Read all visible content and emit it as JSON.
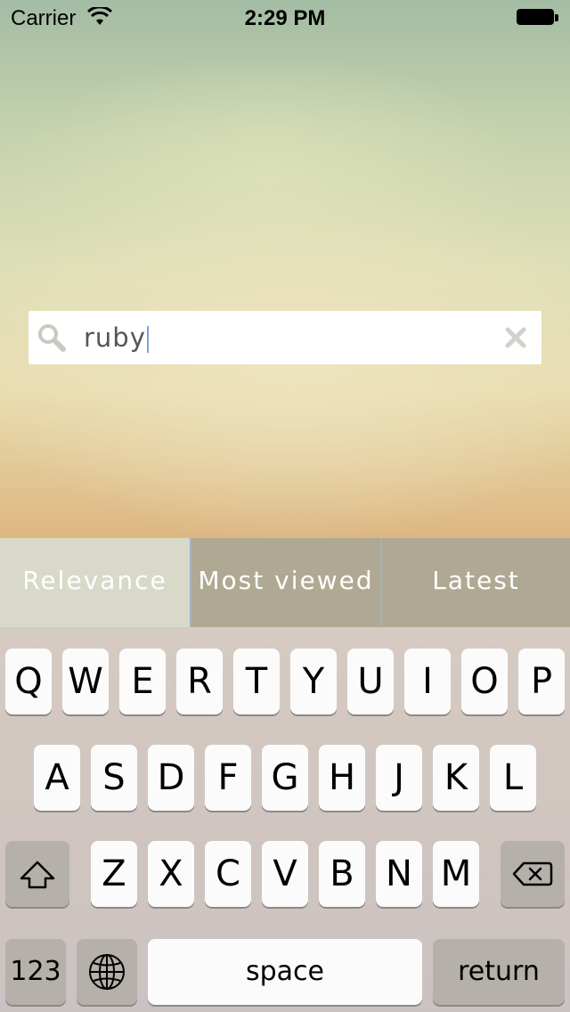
{
  "status_bar": {
    "carrier": "Carrier",
    "time": "2:29 PM"
  },
  "search": {
    "value": "ruby",
    "icon": "search-icon",
    "clear_icon": "clear-icon"
  },
  "sort_tabs": [
    {
      "label": "Relevance",
      "active": true
    },
    {
      "label": "Most viewed",
      "active": false
    },
    {
      "label": "Latest",
      "active": false
    }
  ],
  "keyboard": {
    "row1": [
      "Q",
      "W",
      "E",
      "R",
      "T",
      "Y",
      "U",
      "I",
      "O",
      "P"
    ],
    "row2": [
      "A",
      "S",
      "D",
      "F",
      "G",
      "H",
      "J",
      "K",
      "L"
    ],
    "row3": [
      "Z",
      "X",
      "C",
      "V",
      "B",
      "N",
      "M"
    ],
    "numbers_label": "123",
    "space_label": "space",
    "return_label": "return",
    "shift_icon": "shift-icon",
    "globe_icon": "globe-icon",
    "delete_icon": "delete-icon"
  },
  "colors": {
    "segment_active": "#d8d9c8",
    "segment_inactive": "#afa993",
    "key_face": "#fbfbfb",
    "function_key": "#b5b0aa"
  }
}
